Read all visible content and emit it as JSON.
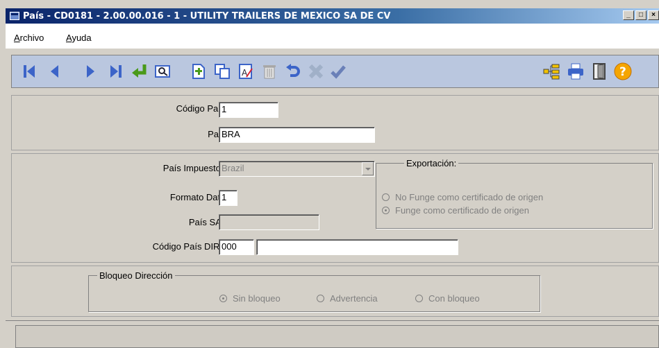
{
  "window": {
    "title": "País - CD0181 - 2.00.00.016 - 1 - UTILITY TRAILERS DE MEXICO SA DE CV"
  },
  "menu": {
    "archivo_first": "A",
    "archivo_rest": "rchivo",
    "ayuda_first": "A",
    "ayuda_rest": "yuda"
  },
  "toolbar": {
    "icons": [
      "first-record-icon",
      "previous-record-icon",
      "next-record-icon",
      "last-record-icon",
      "return-icon",
      "search-icon",
      "new-record-icon",
      "copy-icon",
      "edit-icon",
      "delete-icon",
      "undo-icon",
      "cancel-icon",
      "confirm-icon",
      "tree-icon",
      "print-icon",
      "exit-icon",
      "help-icon"
    ]
  },
  "form": {
    "codigo_pais": {
      "label": "Código País:",
      "value": "1"
    },
    "pais": {
      "label": "Pais:",
      "value": "BRA"
    },
    "pais_impuestos": {
      "label": "País Impuestos:",
      "value": "Brazil"
    },
    "formato_data": {
      "label": "Formato Data:",
      "value": "1"
    },
    "pais_sat": {
      "label": "País SAT:",
      "value": ""
    },
    "codigo_pais_dirf": {
      "label": "Código País DIRF:",
      "value": "000",
      "description": ""
    },
    "exportacion": {
      "legend": "Exportación:",
      "options": [
        {
          "label": "No Funge como certificado de origen",
          "selected": false
        },
        {
          "label": "Funge como certificado de origen",
          "selected": true
        }
      ]
    },
    "bloqueo": {
      "legend": "Bloqueo Dirección",
      "options": [
        {
          "label": "Sin bloqueo",
          "selected": true
        },
        {
          "label": "Advertencia",
          "selected": false
        },
        {
          "label": "Con bloqueo",
          "selected": false
        }
      ]
    }
  },
  "colors": {
    "toolbar_bg": "#bac7df",
    "nav_blue": "#3c64c8",
    "titlebar": "#0a246a"
  }
}
